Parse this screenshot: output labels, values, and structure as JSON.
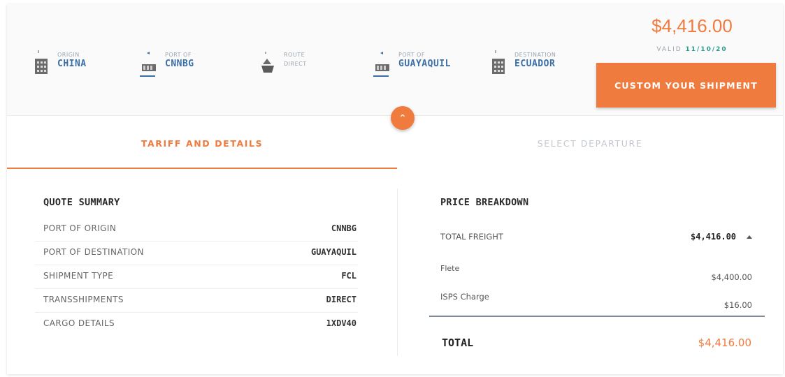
{
  "route": {
    "origin": {
      "label": "ORIGIN",
      "value": "CHINA"
    },
    "port_of_origin": {
      "label": "PORT OF",
      "value": "CNNBG"
    },
    "route": {
      "label": "ROUTE",
      "value": "DIRECT"
    },
    "port_of_destination": {
      "label": "PORT OF",
      "value": "GUAYAQUIL"
    },
    "destination": {
      "label": "DESTINATION",
      "value": "ECUADOR"
    }
  },
  "price": {
    "amount": "$4,416.00",
    "valid_label": "VALID",
    "valid_date": "11/10/20"
  },
  "actions": {
    "custom_button": "CUSTOM YOUR SHIPMENT",
    "toggle_symbol": "⌃"
  },
  "tabs": {
    "tariff": "TARIFF AND DETAILS",
    "departure": "SELECT DEPARTURE"
  },
  "quote_summary": {
    "title": "QUOTE SUMMARY",
    "rows": [
      {
        "key": "PORT OF ORIGIN",
        "value": "CNNBG"
      },
      {
        "key": "PORT OF DESTINATION",
        "value": "GUAYAQUIL"
      },
      {
        "key": "SHIPMENT TYPE",
        "value": "FCL"
      },
      {
        "key": "TRANSSHIPMENTS",
        "value": "DIRECT"
      },
      {
        "key": "CARGO DETAILS",
        "value": "1XDV40"
      }
    ]
  },
  "price_breakdown": {
    "title": "PRICE BREAKDOWN",
    "total_freight_label": "TOTAL FREIGHT",
    "total_freight_value": "$4,416.00",
    "items": [
      {
        "label": "Flete",
        "value": "$4,400.00"
      },
      {
        "label": "ISPS Charge",
        "value": "$16.00"
      }
    ],
    "total_label": "TOTAL",
    "total_value": "$4,416.00"
  },
  "colors": {
    "accent": "#f07b3f",
    "link_blue": "#3b6fa8",
    "valid_green": "#2a9d8f"
  }
}
